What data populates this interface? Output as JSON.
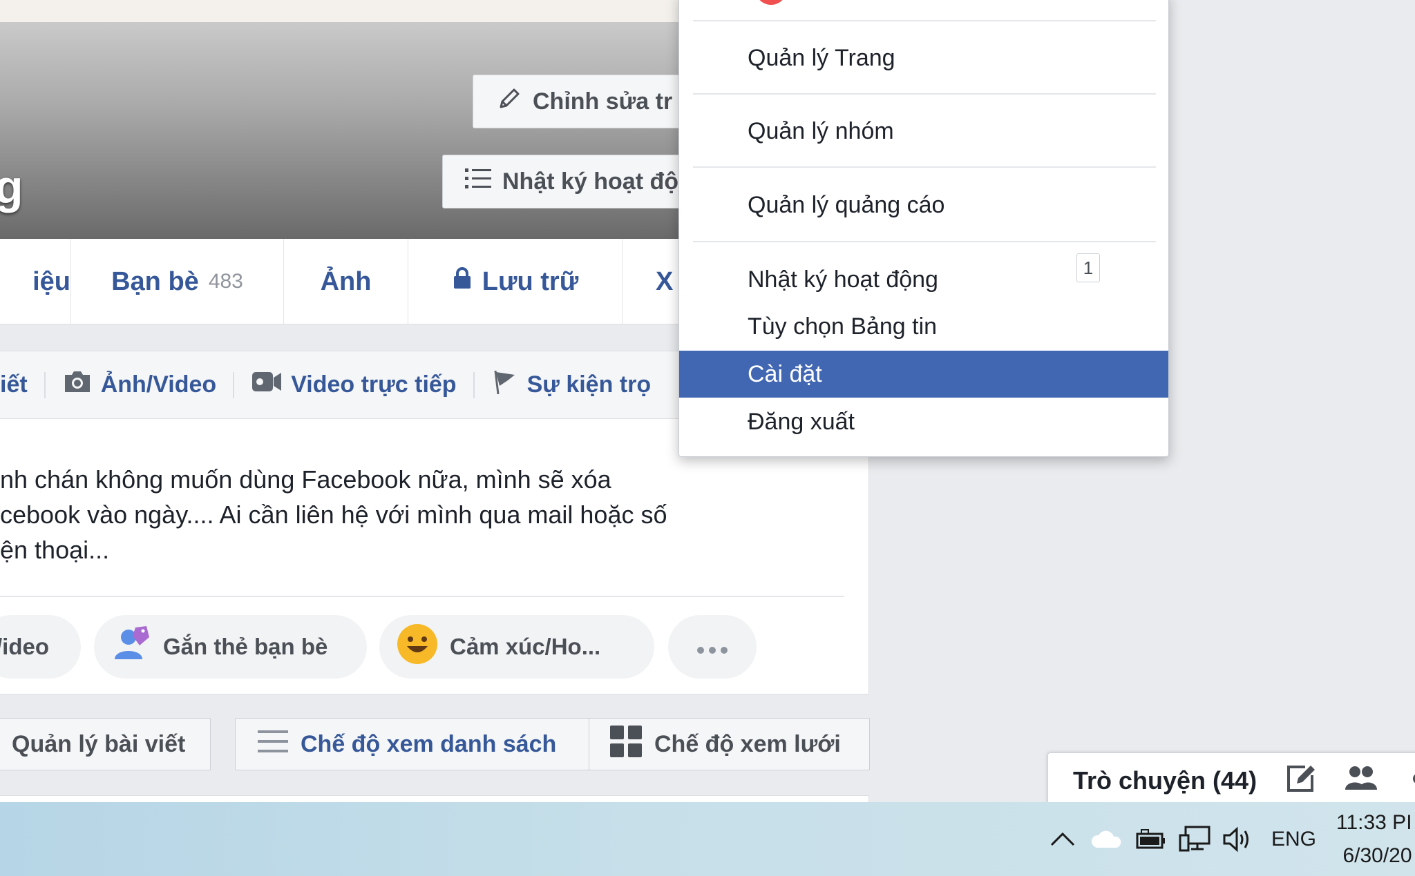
{
  "cover": {
    "name_fragment": "g",
    "edit_button": "Chỉnh sửa tr",
    "activity_log_button": "Nhật ký hoạt độ"
  },
  "tabs": [
    {
      "label": "iệu"
    },
    {
      "label": "Bạn bè",
      "count": "483"
    },
    {
      "label": "Ảnh"
    },
    {
      "label": "Lưu trữ"
    },
    {
      "label": "X"
    }
  ],
  "composer": {
    "head_items": [
      "iết",
      "Ảnh/Video",
      "Video trực tiếp",
      "Sự kiện trọ"
    ],
    "text_lines": [
      "nh chán không muốn dùng Facebook nữa, mình sẽ xóa",
      "cebook vào ngày.... Ai cần liên hệ với mình qua mail hoặc số",
      "ện thoại..."
    ],
    "pills": {
      "video": "/ideo",
      "tag_friends": "Gắn thẻ bạn bè",
      "feeling": "Cảm xúc/Ho..."
    }
  },
  "view_buttons": {
    "manage_posts": "Quản lý bài viết",
    "list_view": "Chế độ xem danh sách",
    "grid_view": "Chế độ xem lưới"
  },
  "menu": {
    "items": [
      {
        "label": "Quản lý Trang"
      },
      {
        "label": "Quản lý nhóm"
      },
      {
        "label": "Quản lý quảng cáo"
      },
      {
        "label": "Nhật ký hoạt động",
        "badge": "1"
      },
      {
        "label": "Tùy chọn Bảng tin"
      },
      {
        "label": "Cài đặt",
        "active": true
      },
      {
        "label": "Đăng xuất"
      }
    ]
  },
  "chat": {
    "label": "Trò chuyện (44)"
  },
  "taskbar": {
    "language": "ENG",
    "time": "11:33 PI",
    "date": "6/30/20"
  },
  "colors": {
    "facebook_blue": "#4267b2",
    "link_blue": "#365899",
    "page_bg": "#e9ebee"
  }
}
